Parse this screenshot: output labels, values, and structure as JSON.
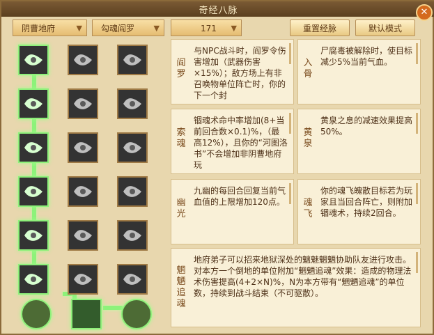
{
  "window": {
    "title": "奇经八脉",
    "close_icon": "close-icon"
  },
  "toolbar": {
    "dropdowns": [
      {
        "label": "阴曹地府",
        "icon": "chevron-down-icon"
      },
      {
        "label": "勾魂阎罗",
        "icon": "chevron-down-icon"
      },
      {
        "label": "171",
        "icon": "chevron-down-icon"
      }
    ],
    "buttons": {
      "reset": "重置经脉",
      "default": "默认模式"
    }
  },
  "skills": [
    {
      "icon": "demon-head-icon",
      "state": "active"
    },
    {
      "icon": "wind-swirl-icon",
      "state": "inactive"
    },
    {
      "icon": "running-figure-icon",
      "state": "inactive"
    },
    {
      "icon": "dagger-icon",
      "state": "active"
    },
    {
      "icon": "glyph-icon",
      "state": "inactive"
    },
    {
      "icon": "arrows-icon",
      "state": "inactive"
    },
    {
      "icon": "swirl-icon",
      "state": "active"
    },
    {
      "icon": "scatter-icon",
      "state": "inactive"
    },
    {
      "icon": "ghost-icon",
      "state": "inactive"
    },
    {
      "icon": "coil-icon",
      "state": "active"
    },
    {
      "icon": "beast-icon",
      "state": "inactive"
    },
    {
      "icon": "crescent-icon",
      "state": "inactive"
    },
    {
      "icon": "scroll-icon",
      "state": "active"
    },
    {
      "icon": "knot-icon",
      "state": "inactive"
    },
    {
      "icon": "flame-icon",
      "state": "inactive"
    },
    {
      "icon": "serpent-icon",
      "state": "active"
    },
    {
      "icon": "wave-icon",
      "state": "inactive"
    },
    {
      "icon": "hand-icon",
      "state": "inactive"
    }
  ],
  "bottom_nodes": [
    {
      "icon": "spiral-orb-icon",
      "state": "active"
    },
    {
      "icon": "open-book-icon",
      "state": "active"
    },
    {
      "icon": "spiral-orb-icon",
      "state": "active"
    }
  ],
  "cards": [
    {
      "label": "阎罗",
      "text": "与NPC战斗时，阎罗令伤害增加（武器伤害×15%）；敌方场上有非召唤物单位阵亡时，你的下一个封"
    },
    {
      "label": "入骨",
      "text": "尸腐毒被解除时，使目标减少5%当前气血。"
    },
    {
      "label": "索魂",
      "text": "锢魂术命中率增加(8+当前回合数×0.1)%，（最高12%），且你的“河图洛书”不会增加非阴曹地府玩"
    },
    {
      "label": "黄泉",
      "text": "黄泉之息的减速效果提高50%。"
    },
    {
      "label": "幽光",
      "text": "九幽的每回合回复当前气血值的上限增加120点。"
    },
    {
      "label": "魂飞",
      "text": "你的魂飞魄散目标若为玩家且当回合阵亡，则附加锢魂术，持续2回合。"
    },
    {
      "label": "魍魉追魂",
      "text": "地府弟子可以招来地狱深处的魑魅魍魉协助队友进行攻击。对本方一个倒地的单位附加“魍魉追魂”效果：造成的物理法术伤害提高(4+2×N)%，N为本方带有“魍魉追魂”的单位数，持续到战斗结束（不可驱散）。"
    }
  ],
  "colors": {
    "active_glow": "#8ef07a",
    "title_bg": "#5b3f1f",
    "panel_bg": "#e8d7ae",
    "text": "#4e3118",
    "label": "#7a4b1d"
  }
}
